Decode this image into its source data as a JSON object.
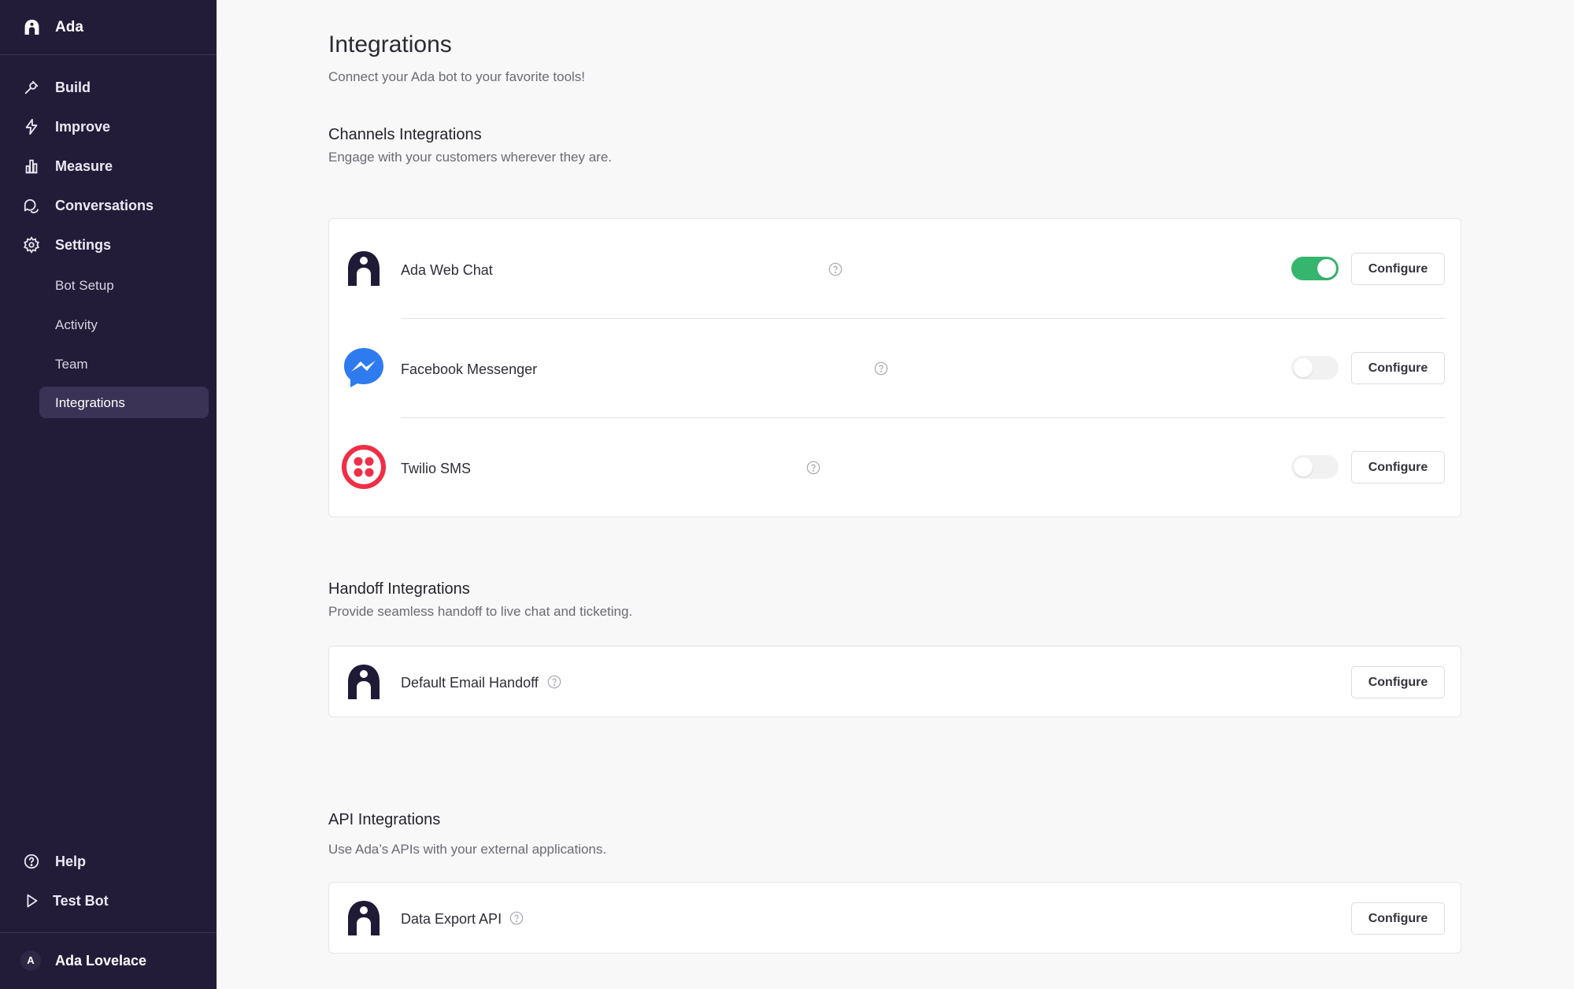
{
  "sidebar": {
    "brand": "Ada",
    "nav": [
      {
        "label": "Build",
        "icon": "build-icon"
      },
      {
        "label": "Improve",
        "icon": "lightning-icon"
      },
      {
        "label": "Measure",
        "icon": "bar-chart-icon"
      },
      {
        "label": "Conversations",
        "icon": "chat-bubbles-icon"
      },
      {
        "label": "Settings",
        "icon": "gear-icon"
      }
    ],
    "settings_sub": [
      "Bot Setup",
      "Activity",
      "Team",
      "Integrations"
    ],
    "active_sub": "Integrations",
    "bottom": [
      {
        "label": "Help",
        "icon": "help-circle-icon"
      },
      {
        "label": "Test Bot",
        "icon": "play-icon"
      }
    ],
    "user": {
      "initial": "A",
      "name": "Ada Lovelace"
    }
  },
  "main": {
    "title": "Integrations",
    "subtitle": "Connect your Ada bot to your favorite tools!",
    "sections": [
      {
        "title": "Channels Integrations",
        "subtitle": "Engage with your customers wherever they are.",
        "items": [
          {
            "name": "Ada Web Chat",
            "enabled": true,
            "button": "Configure",
            "icon": "ada-logo-icon"
          },
          {
            "name": "Facebook Messenger",
            "enabled": false,
            "button": "Configure",
            "icon": "messenger-logo-icon"
          },
          {
            "name": "Twilio SMS",
            "enabled": false,
            "button": "Configure",
            "icon": "twilio-logo-icon"
          }
        ]
      },
      {
        "title": "Handoff Integrations",
        "subtitle": "Provide seamless handoff to live chat and ticketing.",
        "items": [
          {
            "name": "Default Email Handoff",
            "button": "Configure",
            "icon": "ada-logo-icon"
          }
        ]
      },
      {
        "title": "API Integrations",
        "subtitle": "Use Ada’s APIs with your external applications.",
        "items": [
          {
            "name": "Data Export API",
            "button": "Configure",
            "icon": "ada-logo-icon"
          }
        ]
      }
    ]
  },
  "colors": {
    "sidebar_bg": "#231c39",
    "active_item_bg": "#3a3355",
    "toggle_on": "#35b56d",
    "messenger_blue": "#2e7bf0",
    "twilio_red": "#f02e46"
  }
}
